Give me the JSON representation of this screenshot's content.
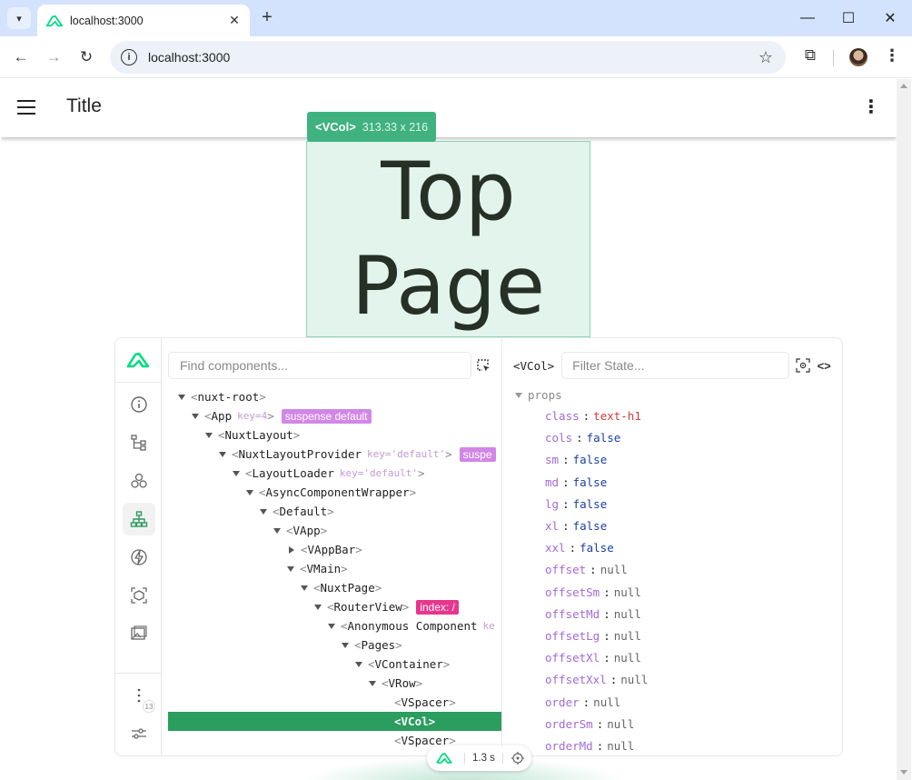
{
  "browser": {
    "tab_title": "localhost:3000",
    "url": "localhost:3000",
    "accent": "#d3e3fd"
  },
  "app": {
    "title": "Title",
    "heading_line1": "Top",
    "heading_line2": "Page"
  },
  "inspector_tip": {
    "component": "<VCol>",
    "dims": "313.33 x 216",
    "color": "#3fb27f"
  },
  "devtools": {
    "find_placeholder": "Find components...",
    "filter_placeholder": "Filter State...",
    "selected_component": "<VCol>",
    "badge_count": "13",
    "timing": "1.3 s",
    "sidebar_icons": [
      "nuxt-logo-icon",
      "info-icon",
      "tree-icon",
      "components-icon",
      "hierarchy-icon",
      "lightning-icon",
      "inspect-icon",
      "image-icon",
      "more-icon",
      "settings-icon"
    ],
    "tree": [
      {
        "indent": 0,
        "open": true,
        "name": "nuxt-root"
      },
      {
        "indent": 1,
        "open": true,
        "name": "App",
        "key": "key=4",
        "pill": "suspense default",
        "pill_color": "purple"
      },
      {
        "indent": 2,
        "open": true,
        "name": "NuxtLayout"
      },
      {
        "indent": 3,
        "open": true,
        "name": "NuxtLayoutProvider",
        "key": "key='default'",
        "pill": "suspe",
        "pill_color": "purple"
      },
      {
        "indent": 4,
        "open": true,
        "name": "LayoutLoader",
        "key": "key='default'"
      },
      {
        "indent": 5,
        "open": true,
        "name": "AsyncComponentWrapper"
      },
      {
        "indent": 6,
        "open": true,
        "name": "Default"
      },
      {
        "indent": 7,
        "open": true,
        "name": "VApp"
      },
      {
        "indent": 8,
        "open": false,
        "name": "VAppBar"
      },
      {
        "indent": 8,
        "open": true,
        "name": "VMain"
      },
      {
        "indent": 9,
        "open": true,
        "name": "NuxtPage"
      },
      {
        "indent": 10,
        "open": true,
        "name": "RouterView",
        "pill": "index: /",
        "pill_color": "pink"
      },
      {
        "indent": 11,
        "open": true,
        "name": "Anonymous Component",
        "key": "ke"
      },
      {
        "indent": 12,
        "open": true,
        "name": "Pages"
      },
      {
        "indent": 13,
        "open": true,
        "name": "VContainer"
      },
      {
        "indent": 14,
        "open": true,
        "name": "VRow"
      },
      {
        "indent": 15,
        "leaf": true,
        "name": "VSpacer"
      },
      {
        "indent": 15,
        "leaf": true,
        "name": "VCol",
        "selected": true
      },
      {
        "indent": 15,
        "leaf": true,
        "name": "VSpacer"
      }
    ],
    "props_label": "props",
    "props": [
      {
        "k": "class",
        "v": "text-h1",
        "t": "str"
      },
      {
        "k": "cols",
        "v": "false",
        "t": "bool"
      },
      {
        "k": "sm",
        "v": "false",
        "t": "bool"
      },
      {
        "k": "md",
        "v": "false",
        "t": "bool"
      },
      {
        "k": "lg",
        "v": "false",
        "t": "bool"
      },
      {
        "k": "xl",
        "v": "false",
        "t": "bool"
      },
      {
        "k": "xxl",
        "v": "false",
        "t": "bool"
      },
      {
        "k": "offset",
        "v": "null",
        "t": "null"
      },
      {
        "k": "offsetSm",
        "v": "null",
        "t": "null"
      },
      {
        "k": "offsetMd",
        "v": "null",
        "t": "null"
      },
      {
        "k": "offsetLg",
        "v": "null",
        "t": "null"
      },
      {
        "k": "offsetXl",
        "v": "null",
        "t": "null"
      },
      {
        "k": "offsetXxl",
        "v": "null",
        "t": "null"
      },
      {
        "k": "order",
        "v": "null",
        "t": "null"
      },
      {
        "k": "orderSm",
        "v": "null",
        "t": "null"
      },
      {
        "k": "orderMd",
        "v": "null",
        "t": "null"
      }
    ]
  }
}
